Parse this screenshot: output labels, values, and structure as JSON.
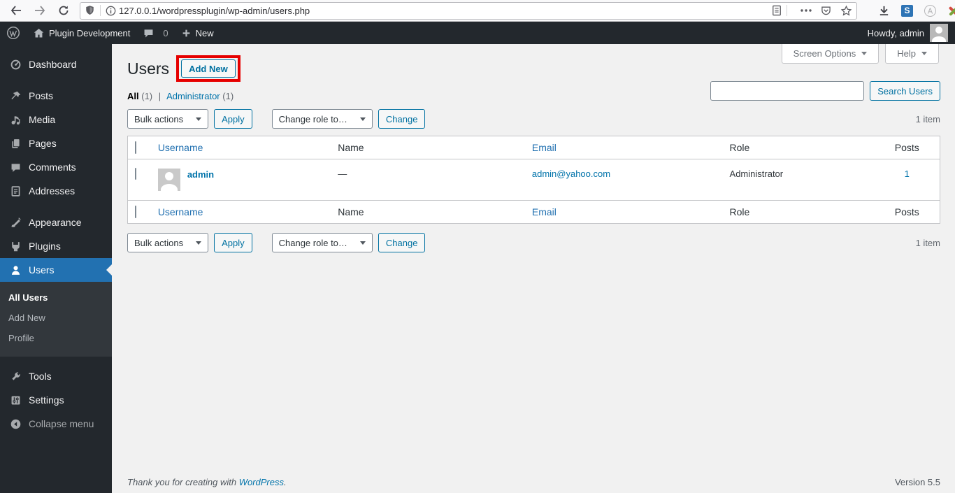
{
  "colors": {
    "accent": "#0073aa",
    "menu_highlight": "#2271b1",
    "annotation": "#e60000",
    "admin_dark": "#23282d",
    "button_blue": "#0071a1"
  },
  "browser": {
    "url": "127.0.0.1/wordpressplugin/wp-admin/users.php"
  },
  "admin_bar": {
    "site_name": "Plugin Development",
    "comments_count": "0",
    "new_label": "New",
    "howdy": "Howdy, admin"
  },
  "sidebar": {
    "menu": [
      {
        "label": "Dashboard"
      },
      {
        "label": "Posts"
      },
      {
        "label": "Media"
      },
      {
        "label": "Pages"
      },
      {
        "label": "Comments"
      },
      {
        "label": "Addresses"
      },
      {
        "label": "Appearance"
      },
      {
        "label": "Plugins"
      },
      {
        "label": "Users"
      },
      {
        "label": "Tools"
      },
      {
        "label": "Settings"
      },
      {
        "label": "Collapse menu"
      }
    ],
    "submenu": [
      "All Users",
      "Add New",
      "Profile"
    ]
  },
  "screen": {
    "screen_options": "Screen Options",
    "help": "Help"
  },
  "page": {
    "title": "Users",
    "add_new": "Add New"
  },
  "views": {
    "all": "All",
    "all_count": "(1)",
    "sep": "|",
    "administrator": "Administrator",
    "admin_count": "(1)"
  },
  "search": {
    "value": "",
    "button": "Search Users"
  },
  "toolbar": {
    "bulk_actions": "Bulk actions",
    "apply": "Apply",
    "change_role": "Change role to…",
    "change": "Change",
    "items": "1 item"
  },
  "table": {
    "columns": [
      "Username",
      "Name",
      "Email",
      "Role",
      "Posts"
    ],
    "row": {
      "username": "admin",
      "name": "—",
      "email": "admin@yahoo.com",
      "role": "Administrator",
      "posts": "1"
    }
  },
  "footer": {
    "thanks_prefix": "Thank you for creating with ",
    "link": "WordPress",
    "suffix": ".",
    "version": "Version 5.5"
  }
}
